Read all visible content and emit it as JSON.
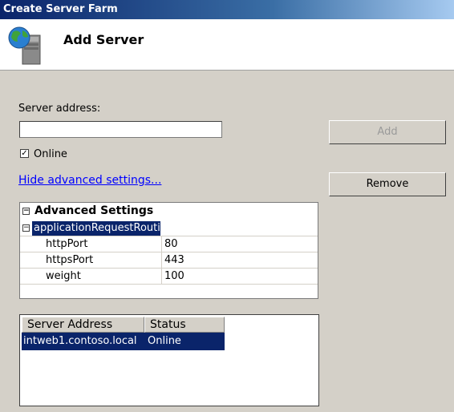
{
  "window": {
    "title": "Create Server Farm"
  },
  "header": {
    "title": "Add Server",
    "icon": "server-globe-icon"
  },
  "form": {
    "server_address_label": "Server address:",
    "server_address_value": "",
    "online_label": "Online",
    "online_checked": true,
    "hide_advanced_link": "Hide advanced settings..."
  },
  "buttons": {
    "add": "Add",
    "remove": "Remove"
  },
  "advanced": {
    "category": "Advanced Settings",
    "sub_category": "applicationRequestRoutir",
    "rows": [
      {
        "name": "httpPort",
        "value": "80"
      },
      {
        "name": "httpsPort",
        "value": "443"
      },
      {
        "name": "weight",
        "value": "100"
      }
    ]
  },
  "server_list": {
    "columns": [
      "Server Address",
      "Status"
    ],
    "rows": [
      {
        "address": "intweb1.contoso.local",
        "status": "Online"
      }
    ]
  }
}
